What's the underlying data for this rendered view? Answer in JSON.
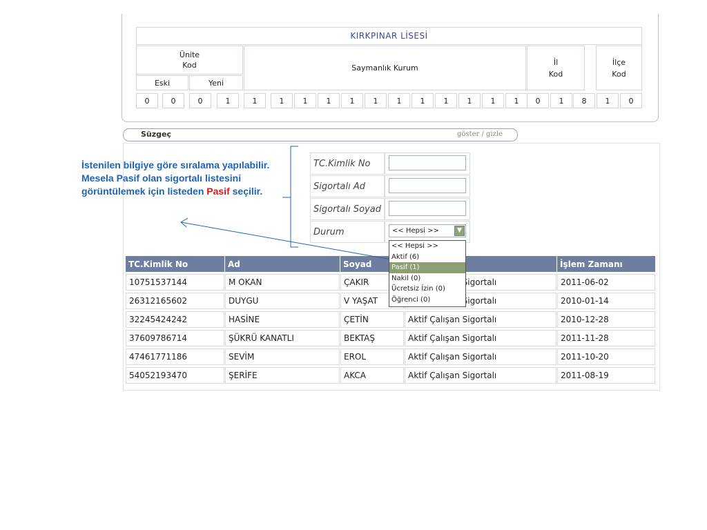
{
  "header": {
    "school_name": "KIRKPINAR LİSESİ",
    "unite_kod": "Ünite\nKod",
    "eski": "Eski",
    "yeni": "Yeni",
    "saymanlik_kurum": "Saymanlık Kurum",
    "il_kod": "İl\nKod",
    "ilce_kod": "İlçe\nKod",
    "digits": [
      "0",
      "0",
      "0",
      "1",
      "1",
      "1",
      "1",
      "1",
      "1",
      "1",
      "1",
      "1",
      "1",
      "1",
      "1",
      "1",
      "0",
      "1",
      "8",
      "1",
      "0"
    ]
  },
  "filter": {
    "title": "Süzgeç",
    "toggle": "göster / gizle",
    "fields": [
      {
        "label": "TC.Kimlik No",
        "value": ""
      },
      {
        "label": "Sigortalı Ad",
        "value": ""
      },
      {
        "label": "Sigortalı Soyad",
        "value": ""
      }
    ],
    "durum_label": "Durum",
    "durum_selected": "<< Hepsi >>",
    "options": [
      "<< Hepsi >>",
      "Aktif (6)",
      "Pasif (1)",
      "Nakil (0)",
      "Ücretsiz İzin (0)",
      "Öğrenci (0)"
    ],
    "highlighted_option": "Pasif (1)"
  },
  "table": {
    "columns": [
      "TC.Kimlik No",
      "Ad",
      "Soyad",
      "",
      "İşlem Zamanı"
    ],
    "rows": [
      [
        "10751537144",
        "M OKAN",
        "ÇAKIR",
        "Aktif Çalışan Sigortalı",
        "2011-06-02"
      ],
      [
        "26312165602",
        "DUYGU",
        "V YAŞAT",
        "Aktif Çalışan Sigortalı",
        "2010-01-14"
      ],
      [
        "32245424242",
        "HASİNE",
        "ÇETİN",
        "Aktif Çalışan Sigortalı",
        "2010-12-28"
      ],
      [
        "37609786714",
        "ŞÜKRÜ KANATLI",
        "BEKTAŞ",
        "Aktif Çalışan Sigortalı",
        "2011-11-28"
      ],
      [
        "47461771186",
        "SEVİM",
        "EROL",
        "Aktif Çalışan Sigortalı",
        "2011-10-20"
      ],
      [
        "54052193470",
        "ŞERİFE",
        "AKCA",
        "Aktif Çalışan Sigortalı",
        "2011-08-19"
      ]
    ]
  },
  "annotation": {
    "part1": "İstenilen bilgiye göre sıralama yapılabilir. Mesela Pasif olan sigortalı listesini görüntülemek için listeden ",
    "highlight": "Pasif",
    "part2": " seçilir."
  },
  "colors": {
    "table_header": "#6f7e9e",
    "annotation_text": "#1f64b5",
    "annotation_highlight": "#e01818",
    "selected_option": "#8c9e72",
    "school_name": "#3b4a9c"
  }
}
